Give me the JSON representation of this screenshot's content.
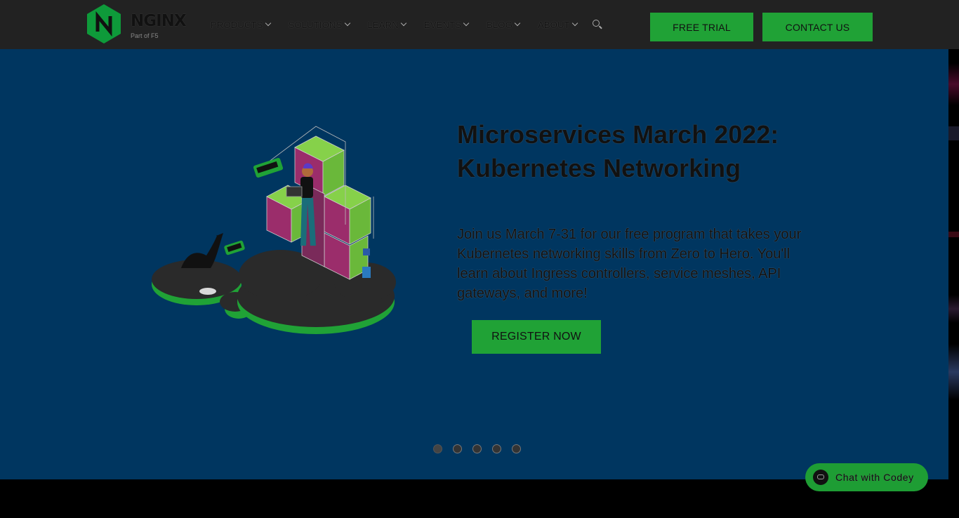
{
  "header": {
    "logo": {
      "word": "NGINX",
      "tagline": "Part of F5",
      "icon": "nginx-hexagon-logo"
    },
    "nav": [
      {
        "label": "PRODUCTS",
        "icon": "chevron-down-icon"
      },
      {
        "label": "SOLUTIONS",
        "icon": "chevron-down-icon"
      },
      {
        "label": "LEARN",
        "icon": "chevron-down-icon"
      },
      {
        "label": "EVENTS",
        "icon": "chevron-down-icon"
      },
      {
        "label": "BLOG",
        "icon": "chevron-down-icon"
      },
      {
        "label": "ABOUT",
        "icon": "chevron-down-icon"
      }
    ],
    "search_icon": "search-icon",
    "free_trial": "FREE TRIAL",
    "contact_us": "CONTACT US"
  },
  "hero": {
    "title": "Microservices March 2022: Kubernetes Networking",
    "description": "Join us March 7-31 for our free program that takes your Kubernetes networking skills from Zero to Hero. You'll learn about Ingress controllers, service meshes, API gateways, and more!",
    "cta": "REGISTER NOW",
    "slides_count": 5,
    "active_slide": 1
  },
  "chat": {
    "label": "Chat with Codey",
    "icon": "chatbot-icon"
  },
  "colors": {
    "topbar": "#222222",
    "hero_bg": "#003660",
    "accent_green": "#20a236",
    "page_bg": "#000000"
  }
}
